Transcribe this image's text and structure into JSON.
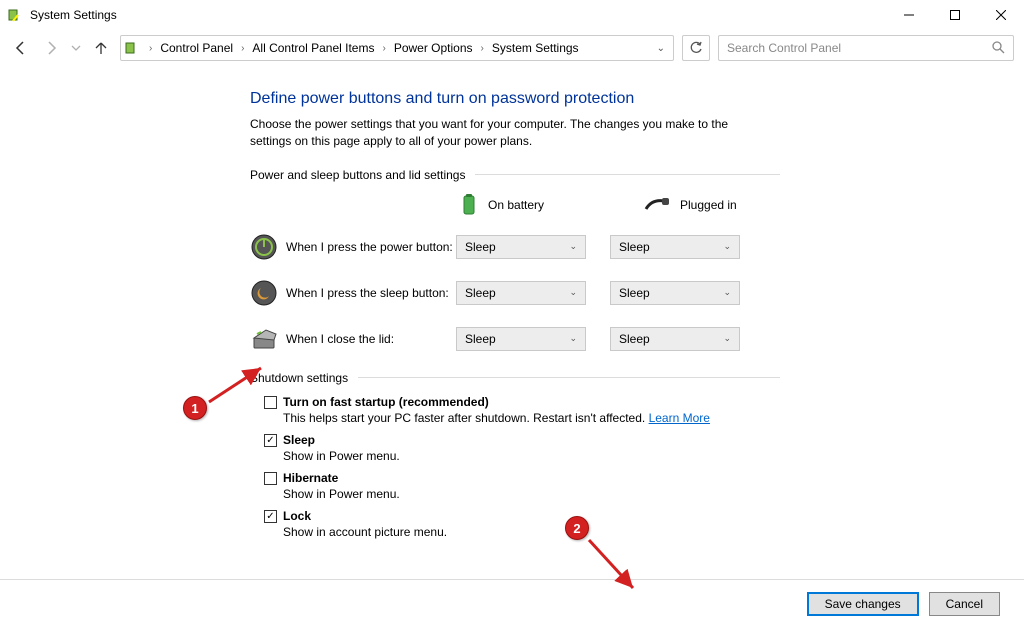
{
  "window": {
    "title": "System Settings"
  },
  "breadcrumb": {
    "items": [
      "Control Panel",
      "All Control Panel Items",
      "Power Options",
      "System Settings"
    ]
  },
  "search": {
    "placeholder": "Search Control Panel"
  },
  "page": {
    "title": "Define power buttons and turn on password protection",
    "desc": "Choose the power settings that you want for your computer. The changes you make to the settings on this page apply to all of your power plans."
  },
  "buttons_section": {
    "group_label": "Power and sleep buttons and lid settings",
    "col_headers": {
      "battery": "On battery",
      "plugged": "Plugged in"
    },
    "rows": [
      {
        "label": "When I press the power button:",
        "battery": "Sleep",
        "plugged": "Sleep"
      },
      {
        "label": "When I press the sleep button:",
        "battery": "Sleep",
        "plugged": "Sleep"
      },
      {
        "label": "When I close the lid:",
        "battery": "Sleep",
        "plugged": "Sleep"
      }
    ]
  },
  "shutdown": {
    "group_label": "Shutdown settings",
    "items": [
      {
        "label": "Turn on fast startup (recommended)",
        "desc_prefix": "This helps start your PC faster after shutdown. Restart isn't affected. ",
        "link": "Learn More",
        "checked": false
      },
      {
        "label": "Sleep",
        "desc": "Show in Power menu.",
        "checked": true
      },
      {
        "label": "Hibernate",
        "desc": "Show in Power menu.",
        "checked": false
      },
      {
        "label": "Lock",
        "desc": "Show in account picture menu.",
        "checked": true
      }
    ]
  },
  "footer": {
    "save": "Save changes",
    "cancel": "Cancel"
  },
  "callouts": {
    "one": "1",
    "two": "2"
  }
}
